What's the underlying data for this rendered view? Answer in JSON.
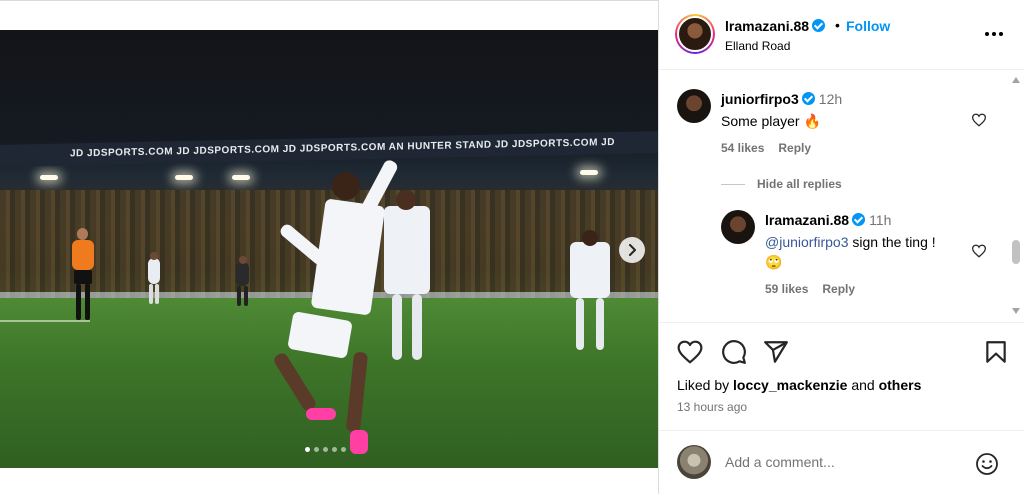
{
  "post": {
    "username": "lramazani.88",
    "follow_label": "Follow",
    "separator": "•",
    "location": "Elland Road"
  },
  "photo": {
    "hoarding_text": "JD JDSPORTS.COM   JD JDSPORTS.COM   JD JDSPORTS.COM   AN HUNTER STAND   JD JDSPORTS.COM   JD",
    "slide_count": 5,
    "active_slide": 1
  },
  "comments": [
    {
      "username": "juniorfirpo3",
      "time": "12h",
      "text": "Some player 🔥",
      "likes": "54 likes",
      "reply_label": "Reply",
      "hide_replies_label": "Hide all replies"
    },
    {
      "username": "lramazani.88",
      "time": "11h",
      "mention": "@juniorfirpo3",
      "text": " sign the ting !",
      "emoji": "🙄",
      "likes": "59 likes",
      "reply_label": "Reply"
    }
  ],
  "engagement": {
    "liked_by_prefix": "Liked by ",
    "liked_by_user": "loccy_mackenzie",
    "liked_by_middle": " and ",
    "liked_by_others": "others",
    "time_ago": "13 hours ago"
  },
  "composer": {
    "placeholder": "Add a comment..."
  },
  "icons": {
    "like": "heart-icon",
    "comment": "comment-icon",
    "share": "share-icon",
    "save": "bookmark-icon",
    "emoji": "emoji-icon",
    "more": "more-icon",
    "next": "chevron-right-icon"
  },
  "colors": {
    "accent": "#0095f6",
    "muted": "#737373",
    "mention": "#385898"
  }
}
